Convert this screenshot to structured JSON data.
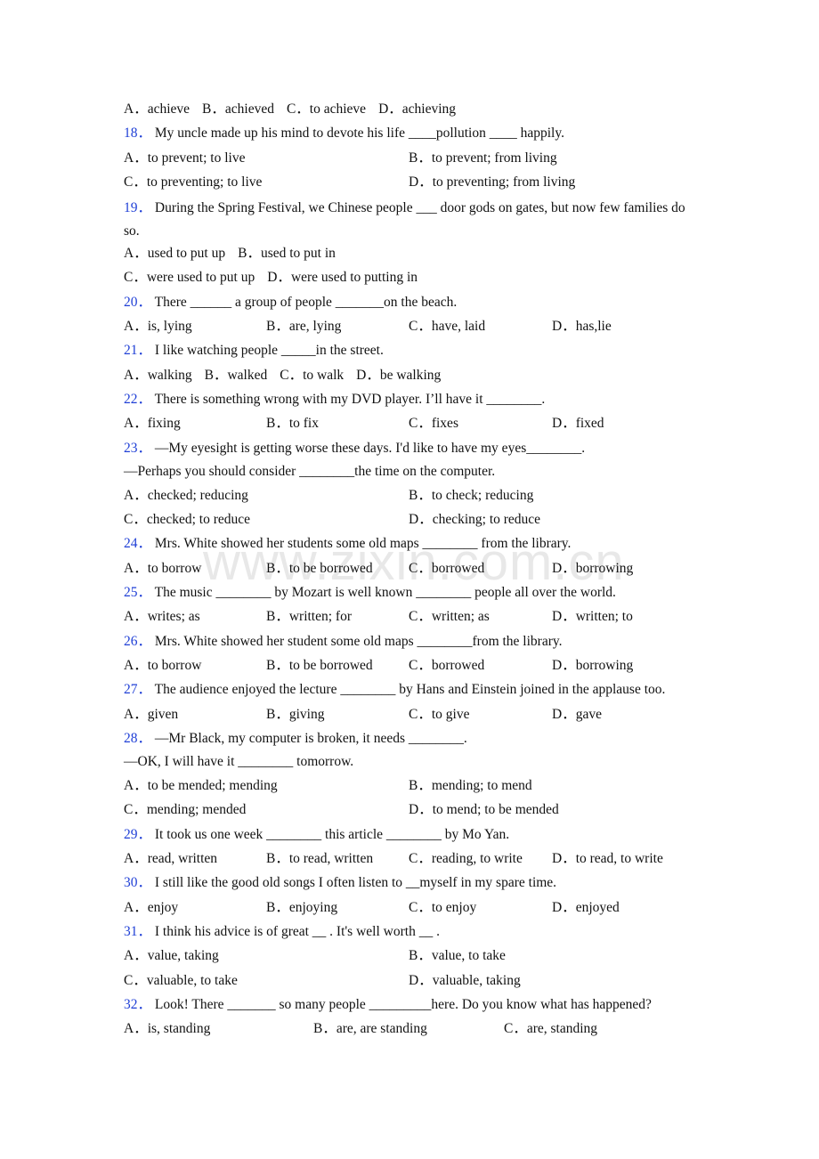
{
  "watermark": "www.zixin.com.cn",
  "leading_options": {
    "layout": "inline",
    "options": [
      {
        "letter": "A．",
        "text": "achieve"
      },
      {
        "letter": "B．",
        "text": "achieved"
      },
      {
        "letter": "C．",
        "text": "to achieve"
      },
      {
        "letter": "D．",
        "text": "achieving"
      }
    ]
  },
  "questions": [
    {
      "number": "18．",
      "stem": [
        "My uncle made up his mind to devote his life ____pollution ____ happily."
      ],
      "layout": "two-col",
      "options": [
        {
          "letter": "A．",
          "text": "to prevent; to live"
        },
        {
          "letter": "B．",
          "text": "to prevent; from living"
        },
        {
          "letter": "C．",
          "text": "to preventing; to live"
        },
        {
          "letter": "D．",
          "text": "to preventing; from living"
        }
      ]
    },
    {
      "number": "19．",
      "stem": [
        "During the Spring Festival, we Chinese people ___ door gods on gates, but now few families do so."
      ],
      "layout": "inline-pairs",
      "options": [
        {
          "letter": "A．",
          "text": "used to put up"
        },
        {
          "letter": "B．",
          "text": "used to put in"
        },
        {
          "letter": "C．",
          "text": "were used to put up"
        },
        {
          "letter": "D．",
          "text": "were used to putting in"
        }
      ]
    },
    {
      "number": "20．",
      "stem": [
        "There ______ a group of people _______on the beach."
      ],
      "layout": "four-col",
      "options": [
        {
          "letter": "A．",
          "text": "is, lying"
        },
        {
          "letter": "B．",
          "text": "are, lying"
        },
        {
          "letter": "C．",
          "text": "have, laid"
        },
        {
          "letter": "D．",
          "text": "has,lie"
        }
      ]
    },
    {
      "number": "21．",
      "stem": [
        "I like watching people _____in the street."
      ],
      "layout": "inline",
      "options": [
        {
          "letter": "A．",
          "text": "walking"
        },
        {
          "letter": "B．",
          "text": "walked"
        },
        {
          "letter": "C．",
          "text": "to walk"
        },
        {
          "letter": "D．",
          "text": "be walking"
        }
      ]
    },
    {
      "number": "22．",
      "stem": [
        "There is something wrong with my DVD player. I’ll have it ________."
      ],
      "layout": "four-col",
      "options": [
        {
          "letter": "A．",
          "text": "fixing"
        },
        {
          "letter": "B．",
          "text": "to fix"
        },
        {
          "letter": "C．",
          "text": "fixes"
        },
        {
          "letter": "D．",
          "text": "fixed"
        }
      ]
    },
    {
      "number": "23．",
      "stem": [
        "—My eyesight is getting worse these days. I'd like to have my eyes________.",
        "—Perhaps you should consider ________the time on the computer."
      ],
      "layout": "two-col",
      "options": [
        {
          "letter": "A．",
          "text": "checked; reducing"
        },
        {
          "letter": "B．",
          "text": "to check; reducing"
        },
        {
          "letter": "C．",
          "text": "checked; to reduce"
        },
        {
          "letter": "D．",
          "text": "checking; to reduce"
        }
      ]
    },
    {
      "number": "24．",
      "stem": [
        "Mrs. White showed her students some old maps ________ from the library."
      ],
      "layout": "four-col",
      "options": [
        {
          "letter": "A．",
          "text": "to borrow"
        },
        {
          "letter": "B．",
          "text": "to be borrowed"
        },
        {
          "letter": "C．",
          "text": "borrowed"
        },
        {
          "letter": "D．",
          "text": "borrowing"
        }
      ]
    },
    {
      "number": "25．",
      "stem": [
        "The music ________ by Mozart is well known ________ people all over the world."
      ],
      "layout": "four-col",
      "options": [
        {
          "letter": "A．",
          "text": "writes; as"
        },
        {
          "letter": "B．",
          "text": "written; for"
        },
        {
          "letter": "C．",
          "text": "written; as"
        },
        {
          "letter": "D．",
          "text": "written; to"
        }
      ]
    },
    {
      "number": "26．",
      "stem": [
        "Mrs. White showed her student some old maps  ________from the library."
      ],
      "layout": "four-col",
      "options": [
        {
          "letter": "A．",
          "text": "to borrow"
        },
        {
          "letter": "B．",
          "text": "to be borrowed"
        },
        {
          "letter": "C．",
          "text": "borrowed"
        },
        {
          "letter": "D．",
          "text": "borrowing"
        }
      ]
    },
    {
      "number": "27．",
      "stem": [
        "The audience enjoyed the lecture ________ by Hans and Einstein joined in the applause too."
      ],
      "layout": "four-col",
      "options": [
        {
          "letter": "A．",
          "text": "given"
        },
        {
          "letter": "B．",
          "text": "giving"
        },
        {
          "letter": "C．",
          "text": "to give"
        },
        {
          "letter": "D．",
          "text": "gave"
        }
      ]
    },
    {
      "number": "28．",
      "stem": [
        "—Mr Black, my computer is broken, it needs ________.",
        "—OK, I will have it ________ tomorrow."
      ],
      "layout": "two-col",
      "options": [
        {
          "letter": "A．",
          "text": "to be mended; mending"
        },
        {
          "letter": "B．",
          "text": "mending; to mend"
        },
        {
          "letter": "C．",
          "text": "mending; mended"
        },
        {
          "letter": "D．",
          "text": "to mend; to be mended"
        }
      ]
    },
    {
      "number": "29．",
      "stem": [
        "It took us one week ________ this article ________ by Mo Yan."
      ],
      "layout": "four-col",
      "options": [
        {
          "letter": "A．",
          "text": "read, written"
        },
        {
          "letter": "B．",
          "text": "to read, written"
        },
        {
          "letter": "C．",
          "text": "reading, to write"
        },
        {
          "letter": "D．",
          "text": "to read, to write"
        }
      ]
    },
    {
      "number": "30．",
      "stem": [
        "I still like the good old songs I often listen to __myself in my spare time."
      ],
      "layout": "four-col",
      "options": [
        {
          "letter": "A．",
          "text": "enjoy"
        },
        {
          "letter": "B．",
          "text": "enjoying"
        },
        {
          "letter": "C．",
          "text": "to enjoy"
        },
        {
          "letter": "D．",
          "text": "enjoyed"
        }
      ]
    },
    {
      "number": "31．",
      "stem": [
        "I think his advice is of great __ . It's well worth __ ."
      ],
      "layout": "two-col",
      "options": [
        {
          "letter": "A．",
          "text": "value, taking"
        },
        {
          "letter": "B．",
          "text": "value, to take"
        },
        {
          "letter": "C．",
          "text": "valuable, to take"
        },
        {
          "letter": "D．",
          "text": "valuable, taking"
        }
      ]
    },
    {
      "number": "32．",
      "stem": [
        "Look! There _______ so many people _________here. Do you know what has happened?"
      ],
      "layout": "three-col",
      "options": [
        {
          "letter": "A．",
          "text": "is, standing"
        },
        {
          "letter": "B．",
          "text": "are, are standing"
        },
        {
          "letter": "C．",
          "text": "are, standing"
        }
      ]
    }
  ]
}
